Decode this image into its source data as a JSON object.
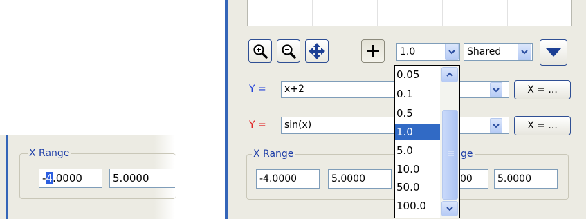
{
  "inset": {
    "group_label": "X Range",
    "x_min_caret_char": "4",
    "x_min_prefix": "-",
    "x_min_suffix": ".0000",
    "x_max": "5.0000"
  },
  "toolbar": {
    "zoom_in_icon": "zoom-in-magnifier",
    "zoom_out_icon": "zoom-out-magnifier",
    "pan_icon": "four-way-arrows",
    "crosshair_icon": "crosshair",
    "step_value": "1.0",
    "axis_mode": "Shared",
    "collapse_icon": "triangle-down"
  },
  "functions": [
    {
      "label": "Y =",
      "expression": "x+2",
      "color": "#1f3fd8",
      "x_button": "X = ..."
    },
    {
      "label": "Y =",
      "expression": "sin(x)",
      "color": "#e02020",
      "x_button": "X = ..."
    }
  ],
  "x_range": {
    "group_label": "X Range",
    "min": "-4.0000",
    "max": "5.0000"
  },
  "y_range": {
    "group_label_visible": "ge",
    "min_visible": "00",
    "max": "5.0000"
  },
  "dropdown": {
    "options": [
      "0.05",
      "0.1",
      "0.5",
      "1.0",
      "5.0",
      "10.0",
      "50.0",
      "100.0"
    ],
    "selected": "1.0"
  },
  "colors": {
    "accent_bar": "#3465b8",
    "selection": "#316ac5",
    "panel_bg": "#ecebe3"
  }
}
